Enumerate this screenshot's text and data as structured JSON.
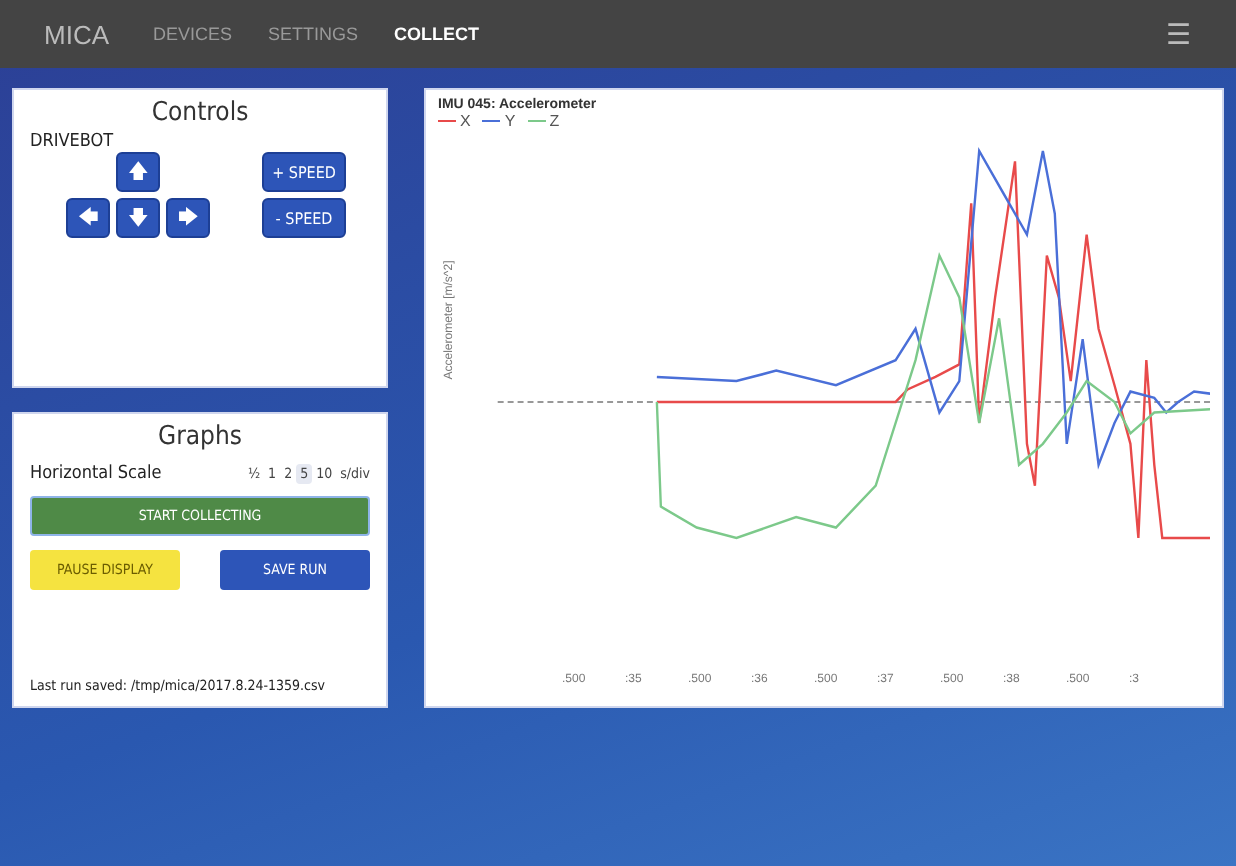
{
  "nav": {
    "brand": "MICA",
    "items": [
      {
        "label": "DEVICES",
        "selected": false
      },
      {
        "label": "SETTINGS",
        "selected": false
      },
      {
        "label": "COLLECT",
        "selected": true
      }
    ],
    "menu_icon": "☰"
  },
  "controls": {
    "title": "Controls",
    "device": "DRIVEBOT",
    "arrows": [
      "🡅",
      "🡄",
      "🡇",
      "🡆"
    ],
    "speed_buttons": [
      "+ SPEED",
      "- SPEED"
    ]
  },
  "graphs": {
    "title": "Graphs",
    "scale_label": "Horizontal Scale",
    "scale_options": [
      {
        "label": "½",
        "selected": false
      },
      {
        "label": "1",
        "selected": false
      },
      {
        "label": "2",
        "selected": false
      },
      {
        "label": "5",
        "selected": true
      },
      {
        "label": "10",
        "selected": false
      }
    ],
    "scale_unit": "s/div",
    "start_button": "START COLLECTING",
    "pause_button": "PAUSE DISPLAY",
    "save_button": "SAVE RUN",
    "last_saved": "Last run saved: /tmp/mica/2017.8.24-1359.csv"
  },
  "chart": {
    "title": "IMU 045: Accelerometer",
    "ylabel": "Accelerometer [m/s^2]",
    "legend": [
      {
        "name": "X",
        "color": "#e84a4a"
      },
      {
        "name": "Y",
        "color": "#4a6fd8"
      },
      {
        "name": "Z",
        "color": "#7cc98a"
      }
    ],
    "xticks": [
      ".500",
      ":35",
      ".500",
      ":36",
      ".500",
      ":37",
      ".500",
      ":38",
      ".500",
      ":3"
    ]
  }
}
